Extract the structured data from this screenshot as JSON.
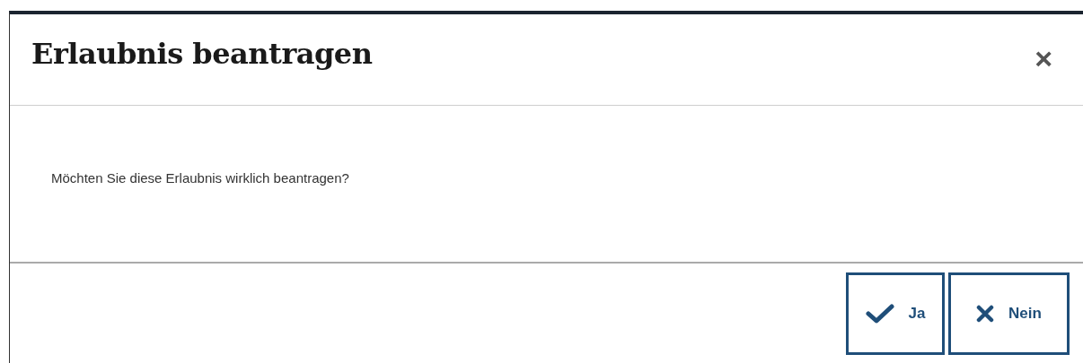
{
  "dialog": {
    "title": "Erlaubnis beantragen",
    "close": "×",
    "message": "Möchten Sie diese Erlaubnis wirklich beantragen?"
  },
  "buttons": [
    {
      "kind": "confirm",
      "label": "Ja"
    },
    {
      "kind": "cancel",
      "label": "Nein"
    }
  ]
}
